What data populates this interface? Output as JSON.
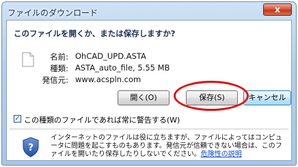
{
  "window": {
    "title": "ファイルのダウンロード",
    "close_label": "x"
  },
  "dialog": {
    "heading": "このファイルを開くか、または保存しますか?",
    "file_info": [
      {
        "label": "名前:",
        "value": "OhCAD_UPD.ASTA"
      },
      {
        "label": "種類:",
        "value": "ASTA_auto_file, 5.55 MB"
      },
      {
        "label": "発信元:",
        "value": "www.acspln.com"
      }
    ],
    "buttons": {
      "open": "開く(O)",
      "save": "保存(S)",
      "cancel": "キャンセル"
    },
    "checkbox": {
      "label": "この種類のファイルであれば常に警告する(W)",
      "checked": true
    },
    "warning": {
      "text": "インターネットのファイルは役に立ちますが、ファイルによってはコンピュータに問題を起こすものもあります。発信元が信頼できない場合は、このファイルを開いたり保存したりしないでください。",
      "link": "危険性の説明"
    }
  },
  "colors": {
    "highlight": "#e01010",
    "close_button": "#c23718",
    "link": "#0b47c7"
  }
}
